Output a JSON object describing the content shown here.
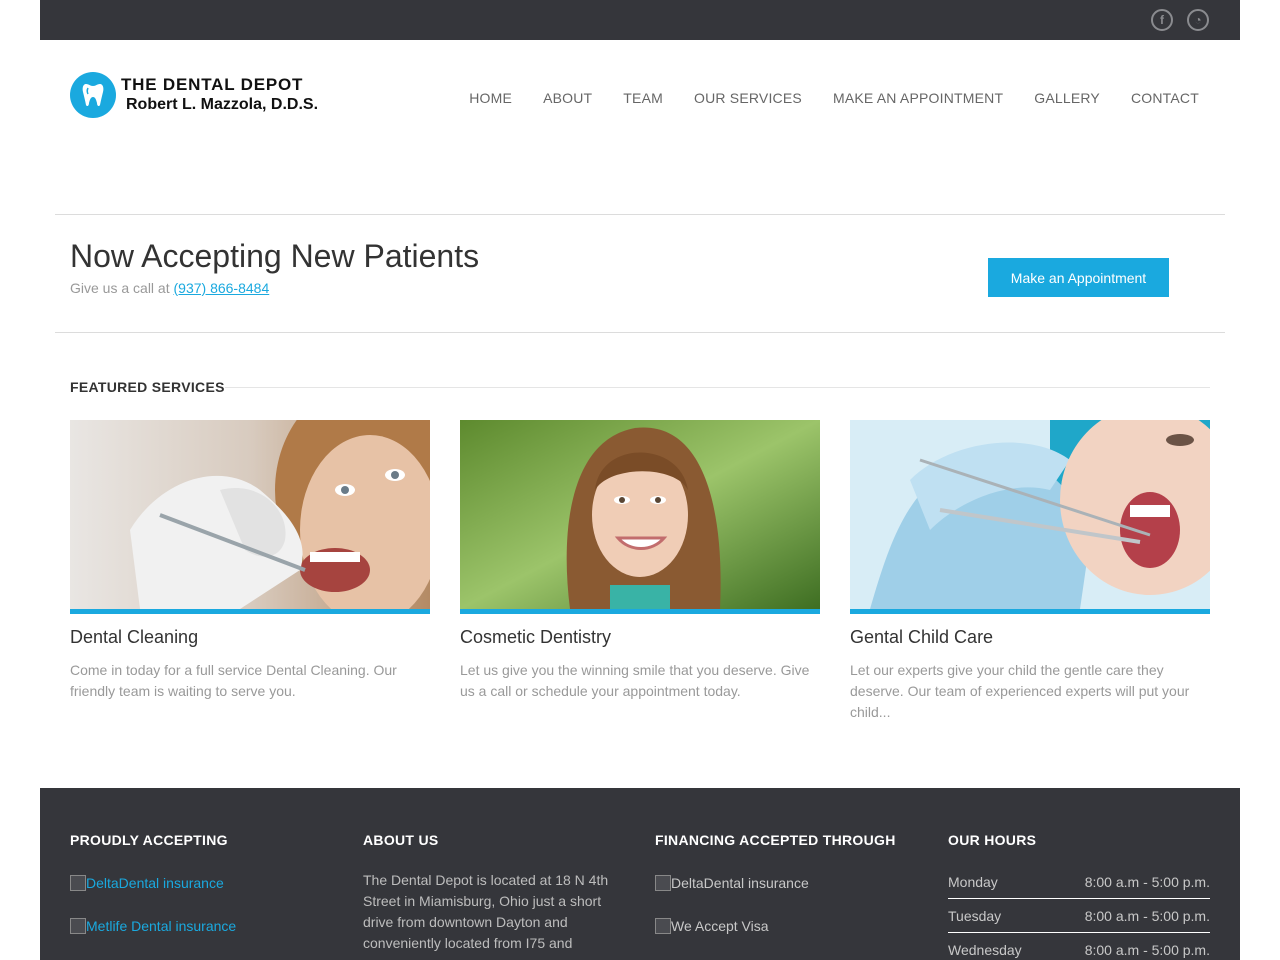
{
  "topbar": {
    "social": [
      {
        "icon": "facebook-icon",
        "glyph": "f"
      },
      {
        "icon": "rss-icon",
        "glyph": "◔"
      }
    ]
  },
  "logo": {
    "line1": "THE DENTAL DEPOT",
    "line2": "Robert L. Mazzola, D.D.S."
  },
  "nav": [
    "HOME",
    "ABOUT",
    "TEAM",
    "OUR SERVICES",
    "MAKE AN APPOINTMENT",
    "GALLERY",
    "CONTACT"
  ],
  "promo": {
    "title": "Now Accepting New Patients",
    "sub_prefix": "Give us a call at",
    "phone": "(937) 866-8484",
    "button": "Make an Appointment"
  },
  "featured": {
    "heading": "FEATURED SERVICES",
    "cards": [
      {
        "title": "Dental Cleaning",
        "text": "Come in today for a full service Dental Cleaning. Our friendly team is waiting to serve you."
      },
      {
        "title": "Cosmetic Dentistry",
        "text": "Let us give you the winning smile that you deserve. Give us a call or schedule your appointment today."
      },
      {
        "title": "Gental Child Care",
        "text": "Let our experts give your child the gentle care they deserve. Our team of experienced experts will put your child..."
      }
    ]
  },
  "footer": {
    "accepting": {
      "heading": "PROUDLY ACCEPTING",
      "items": [
        "DeltaDental insurance",
        "Metlife Dental insurance"
      ]
    },
    "about": {
      "heading": "ABOUT US",
      "text": "The Dental Depot is located at 18 N 4th Street in Miamisburg, Ohio just a short drive from downtown Dayton and conveniently located from I75 and"
    },
    "financing": {
      "heading": "FINANCING ACCEPTED THROUGH",
      "items": [
        "DeltaDental insurance",
        "We Accept Visa"
      ]
    },
    "hours": {
      "heading": "OUR HOURS",
      "rows": [
        {
          "day": "Monday",
          "time": "8:00 a.m - 5:00 p.m."
        },
        {
          "day": "Tuesday",
          "time": "8:00 a.m - 5:00 p.m."
        },
        {
          "day": "Wednesday",
          "time": "8:00 a.m - 5:00 p.m."
        }
      ]
    }
  },
  "colors": {
    "accent": "#1aa9df",
    "dark": "#35363b"
  }
}
